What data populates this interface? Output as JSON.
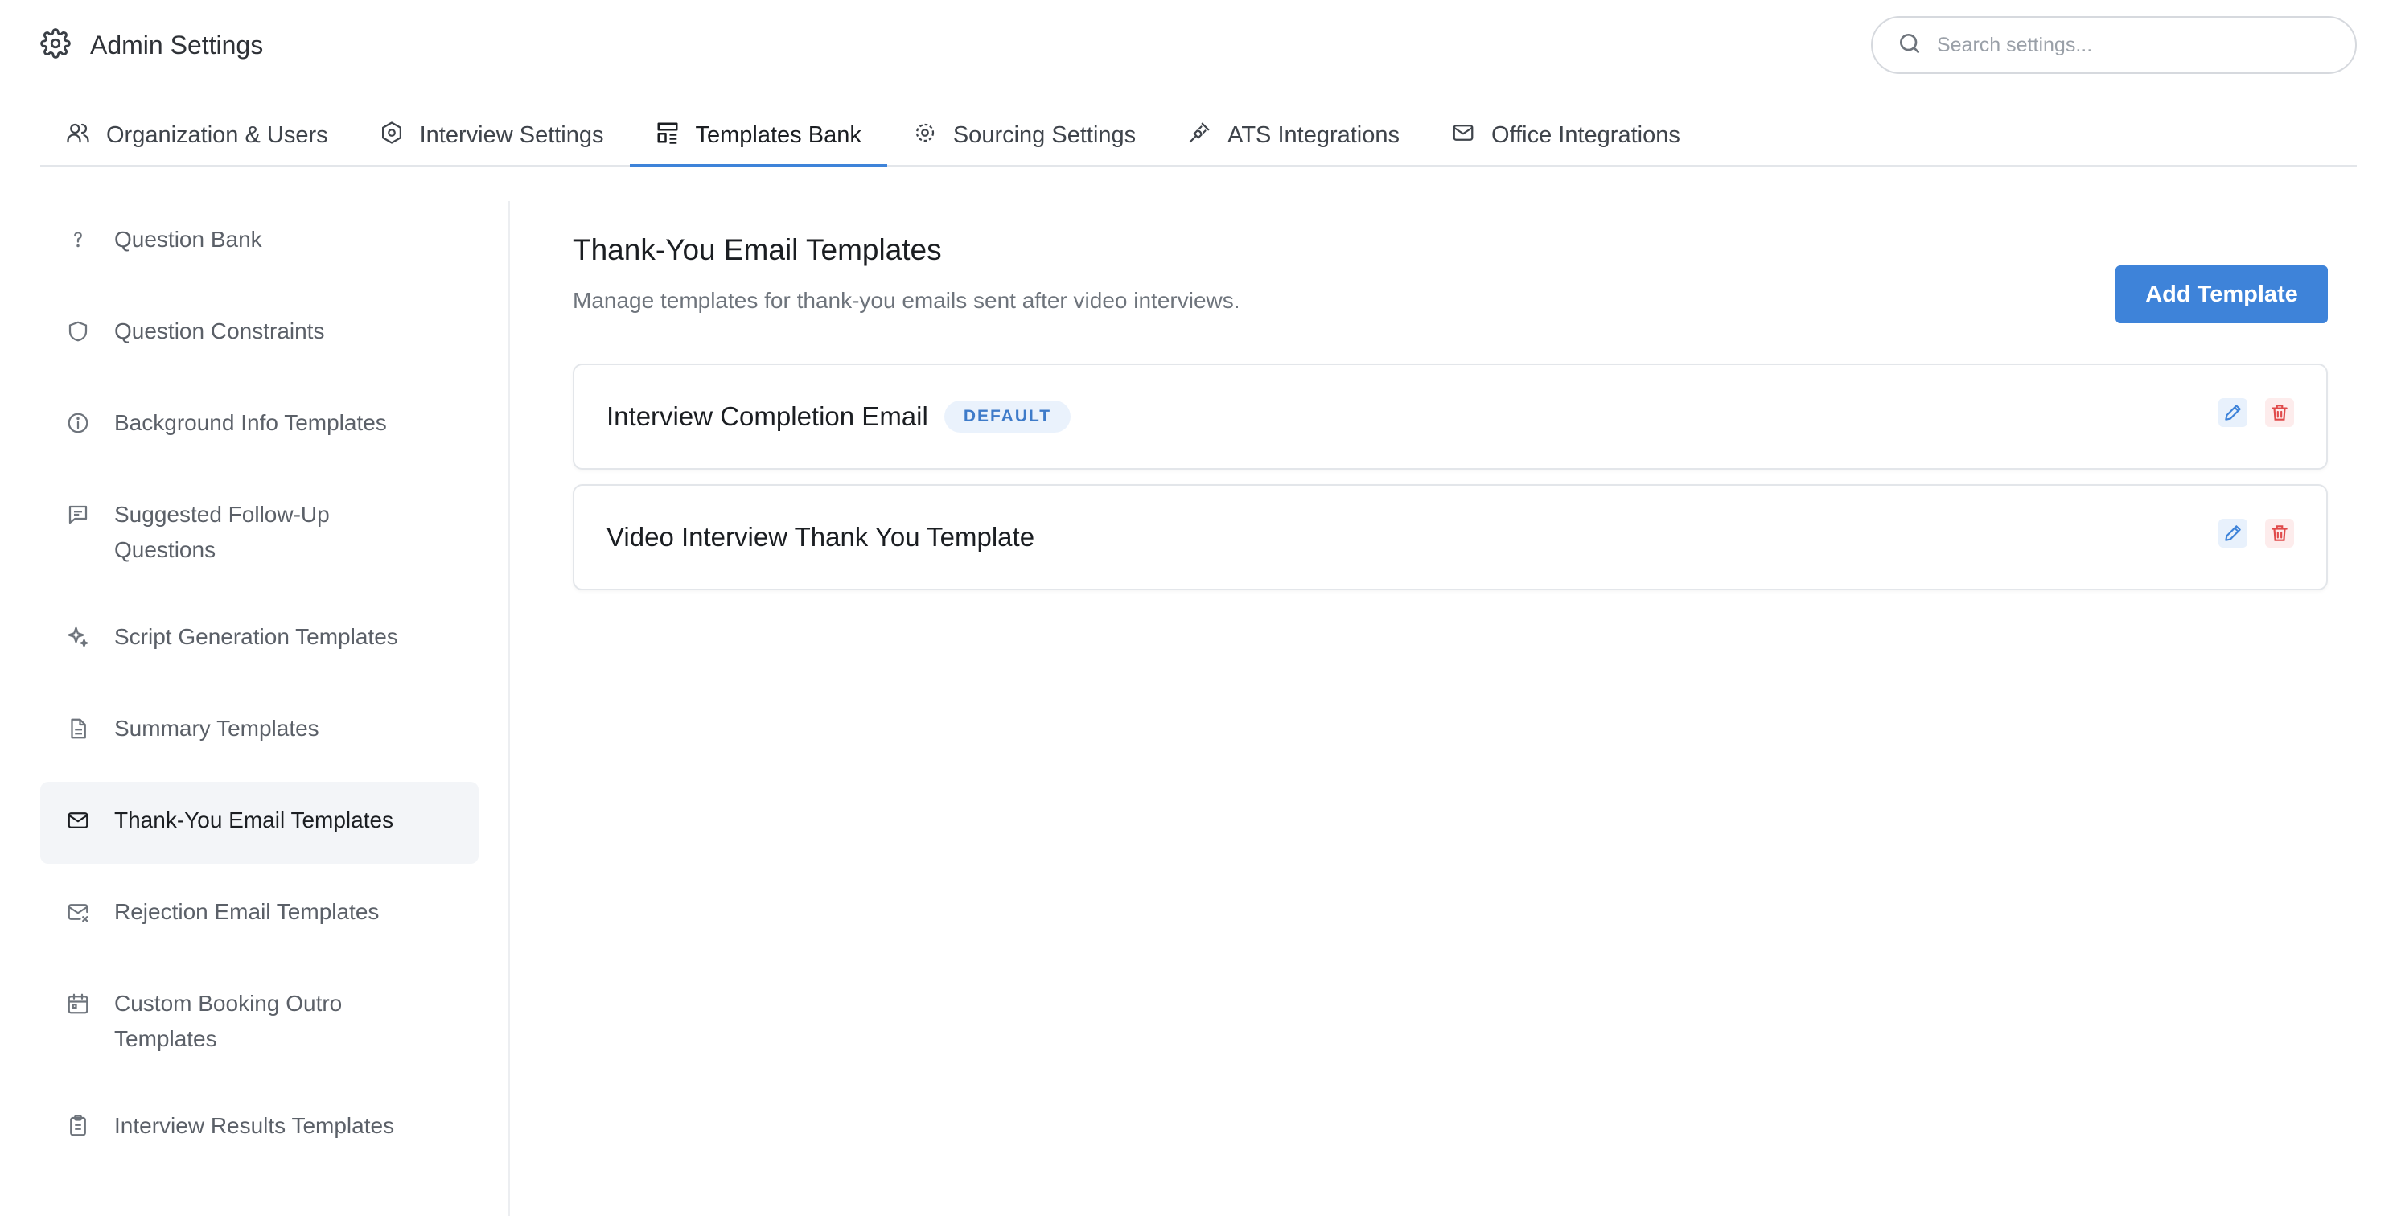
{
  "header": {
    "title": "Admin Settings",
    "search_placeholder": "Search settings..."
  },
  "tabs": [
    {
      "label": "Organization & Users",
      "icon": "users-icon"
    },
    {
      "label": "Interview Settings",
      "icon": "hexagon-gear-icon"
    },
    {
      "label": "Templates Bank",
      "icon": "templates-icon",
      "active": true
    },
    {
      "label": "Sourcing Settings",
      "icon": "gear-icon"
    },
    {
      "label": "ATS Integrations",
      "icon": "plug-icon"
    },
    {
      "label": "Office Integrations",
      "icon": "mail-icon"
    }
  ],
  "sidebar": {
    "items": [
      {
        "label": "Question Bank",
        "icon": "question-icon"
      },
      {
        "label": "Question Constraints",
        "icon": "shield-icon"
      },
      {
        "label": "Background Info Templates",
        "icon": "info-icon"
      },
      {
        "label": "Suggested Follow-Up Questions",
        "icon": "message-question-icon"
      },
      {
        "label": "Script Generation Templates",
        "icon": "sparkles-icon"
      },
      {
        "label": "Summary Templates",
        "icon": "document-icon"
      },
      {
        "label": "Thank-You Email Templates",
        "icon": "mail-icon",
        "active": true
      },
      {
        "label": "Rejection Email Templates",
        "icon": "mail-x-icon"
      },
      {
        "label": "Custom Booking Outro Templates",
        "icon": "calendar-icon"
      },
      {
        "label": "Interview Results Templates",
        "icon": "clipboard-icon"
      }
    ]
  },
  "main": {
    "title": "Thank-You Email Templates",
    "subtitle": "Manage templates for thank-you emails sent after video interviews.",
    "add_label": "Add Template",
    "templates": [
      {
        "name": "Interview Completion Email",
        "badge": "DEFAULT"
      },
      {
        "name": "Video Interview Thank You Template"
      }
    ]
  },
  "colors": {
    "accent": "#3e83d9",
    "danger": "#e04a4a",
    "badge_bg": "#eaf2fc"
  }
}
